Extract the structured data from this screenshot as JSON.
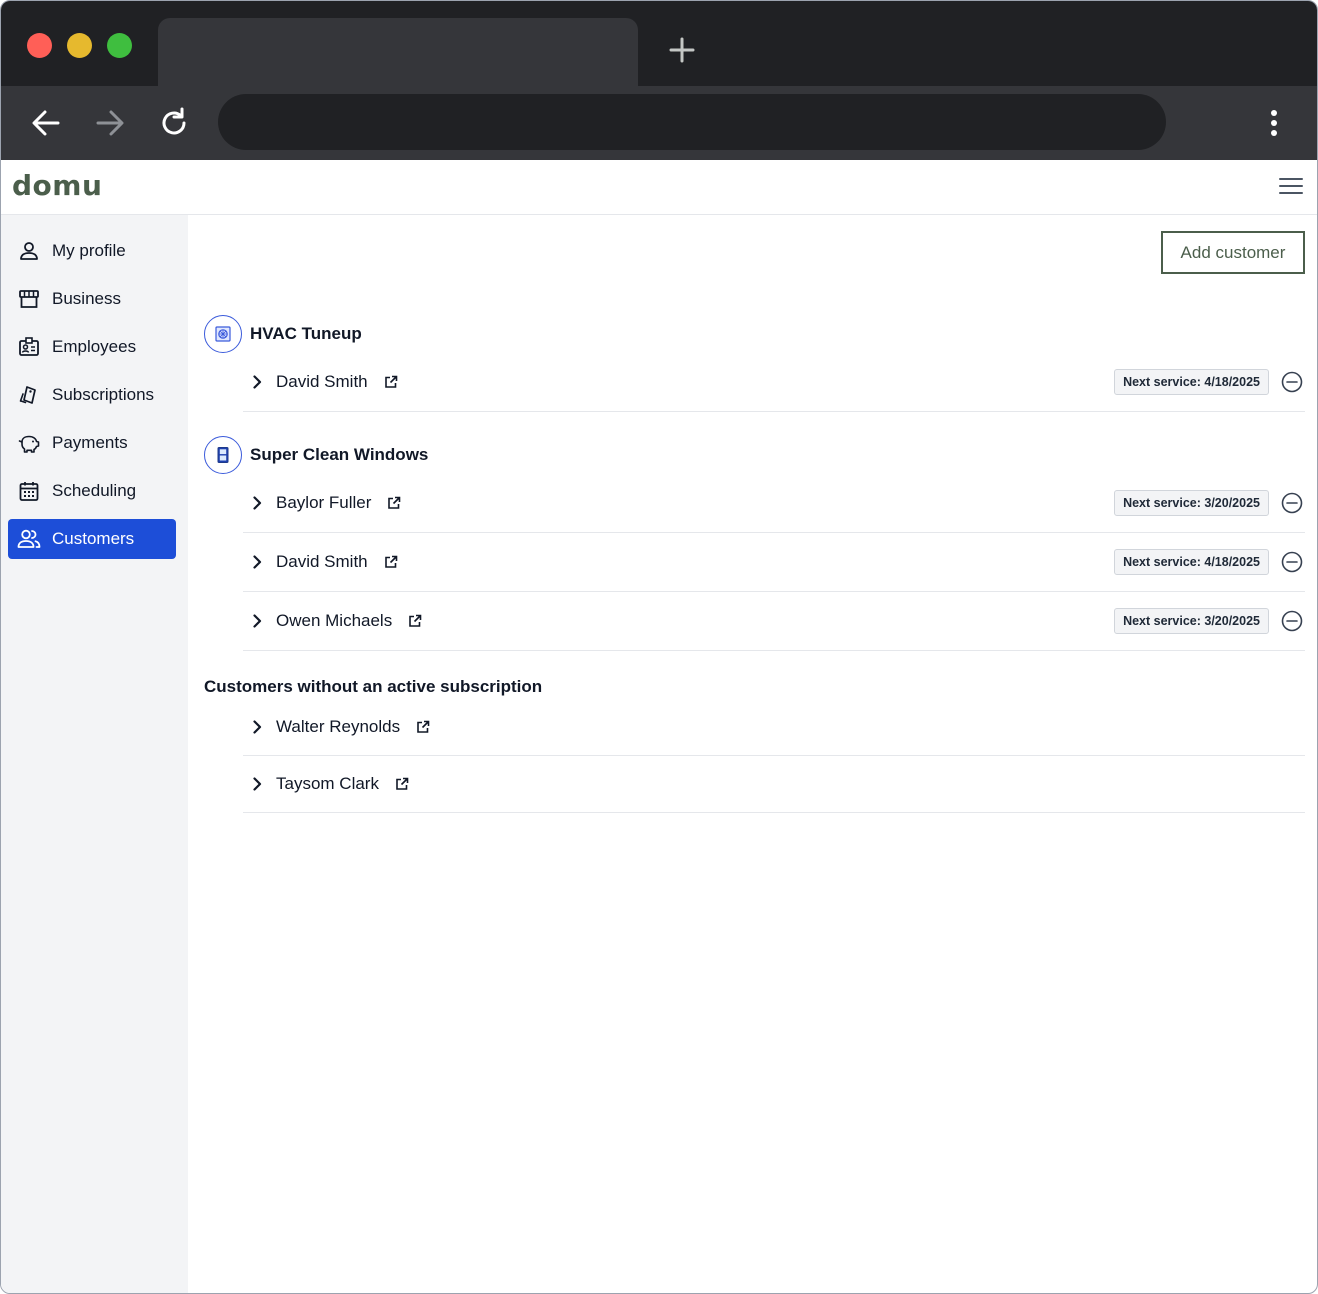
{
  "app": {
    "logo": "domu"
  },
  "sidebar": {
    "items": [
      {
        "label": "My profile",
        "icon": "user-icon",
        "active": false
      },
      {
        "label": "Business",
        "icon": "storefront-icon",
        "active": false
      },
      {
        "label": "Employees",
        "icon": "id-badge-icon",
        "active": false
      },
      {
        "label": "Subscriptions",
        "icon": "tags-icon",
        "active": false
      },
      {
        "label": "Payments",
        "icon": "piggy-bank-icon",
        "active": false
      },
      {
        "label": "Scheduling",
        "icon": "calendar-icon",
        "active": false
      },
      {
        "label": "Customers",
        "icon": "users-icon",
        "active": true
      }
    ]
  },
  "main": {
    "add_customer_label": "Add customer",
    "groups": [
      {
        "title": "HVAC Tuneup",
        "icon": "hvac-unit-icon",
        "rows": [
          {
            "name": "David Smith",
            "next_service": "Next service: 4/18/2025"
          }
        ]
      },
      {
        "title": "Super Clean Windows",
        "icon": "window-icon",
        "rows": [
          {
            "name": "Baylor Fuller",
            "next_service": "Next service: 3/20/2025"
          },
          {
            "name": "David Smith",
            "next_service": "Next service: 4/18/2025"
          },
          {
            "name": "Owen Michaels",
            "next_service": "Next service: 3/20/2025"
          }
        ]
      }
    ],
    "inactive_section_title": "Customers without an active subscription",
    "inactive_rows": [
      {
        "name": "Walter Reynolds"
      },
      {
        "name": "Taysom Clark"
      }
    ]
  },
  "colors": {
    "accent": "#1d4ed8",
    "brand": "#4b5e4b",
    "sidebar_bg": "#f3f4f6"
  }
}
